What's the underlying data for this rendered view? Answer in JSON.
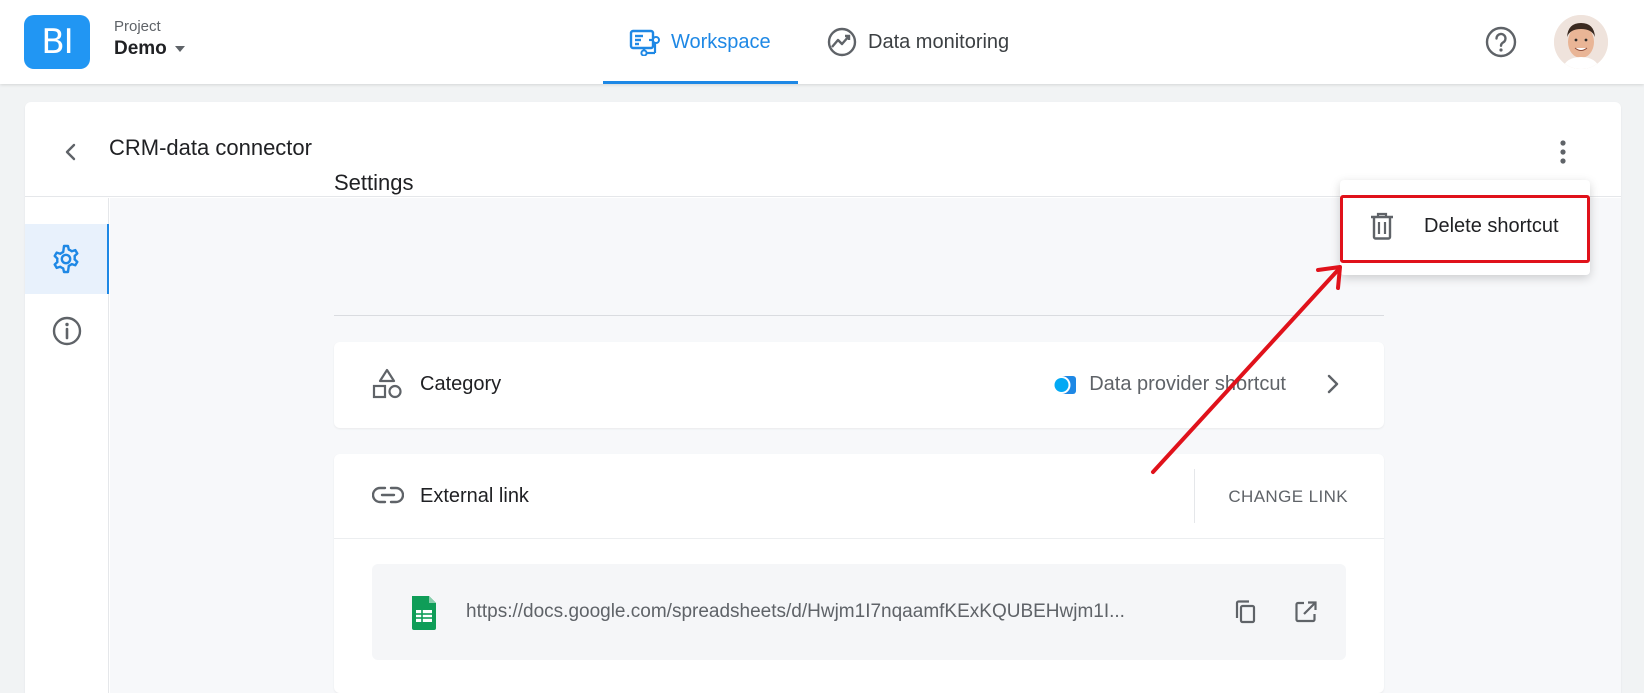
{
  "app": {
    "logo_text": "BI",
    "project_label": "Project",
    "project_name": "Demo"
  },
  "nav": {
    "workspace": "Workspace",
    "monitoring": "Data monitoring"
  },
  "header": {
    "title": "CRM-data connector"
  },
  "settings": {
    "title": "Settings",
    "category_label": "Category",
    "category_value": "Data provider shortcut",
    "external_link_label": "External link",
    "change_link": "CHANGE LINK",
    "url": "https://docs.google.com/spreadsheets/d/Hwjm1I7nqaamfKExKQUBEHwjm1I..."
  },
  "menu": {
    "delete_label": "Delete shortcut"
  },
  "colors": {
    "accent": "#1e88e5",
    "annotation": "#e0121b",
    "sheets_green": "#0f9d58",
    "category_dot": "#03a9f4"
  }
}
